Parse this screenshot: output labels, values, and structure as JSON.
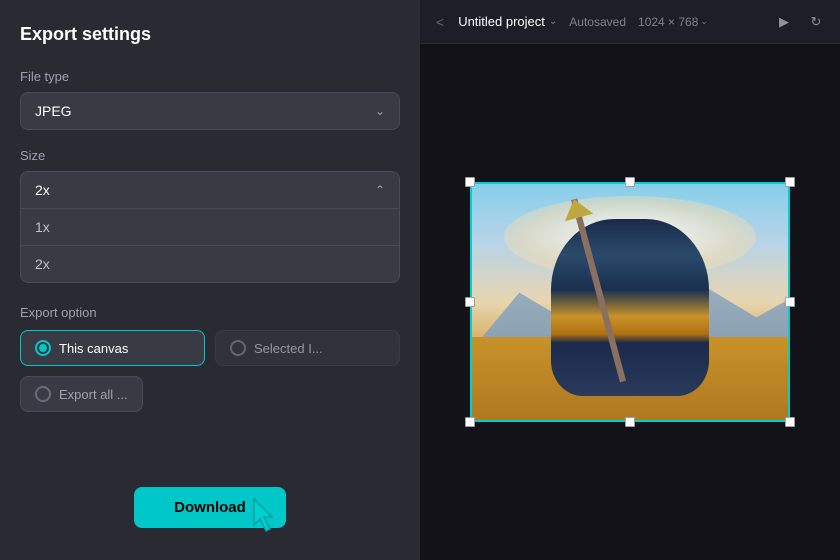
{
  "panel": {
    "title": "Export settings",
    "file_type_label": "File type",
    "file_type_value": "JPEG",
    "size_label": "Size",
    "size_value": "2x",
    "size_options": [
      "1x",
      "2x"
    ],
    "export_option_label": "Export option",
    "export_options": [
      {
        "id": "this_canvas",
        "label": "This canvas",
        "active": true
      },
      {
        "id": "selected",
        "label": "Selected I...",
        "active": false
      }
    ],
    "export_all_label": "Export all ...",
    "download_label": "Download"
  },
  "topbar": {
    "nav_back": "<",
    "project_name": "Untitled project",
    "autosaved": "Autosaved",
    "canvas_size": "1024 × 768"
  }
}
